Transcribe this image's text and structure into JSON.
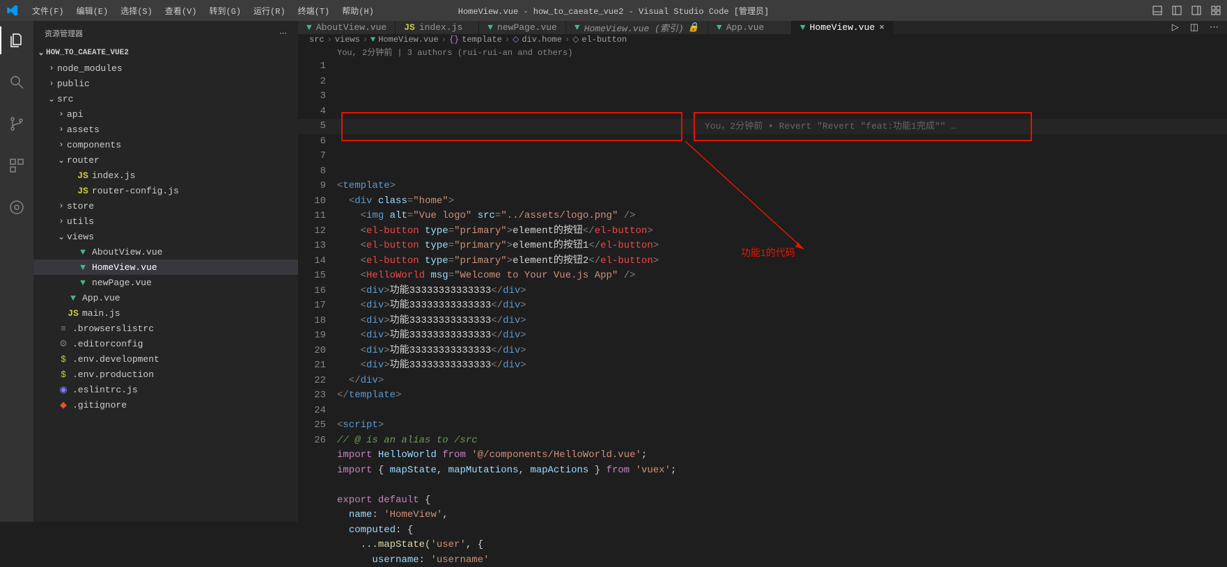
{
  "titlebar": {
    "menus": [
      "文件(F)",
      "编辑(E)",
      "选择(S)",
      "查看(V)",
      "转到(G)",
      "运行(R)",
      "终端(T)",
      "帮助(H)"
    ],
    "title": "HomeView.vue - how_to_caeate_vue2 - Visual Studio Code [管理员]"
  },
  "sidebar": {
    "header": "资源管理器",
    "section": "HOW_TO_CAEATE_VUE2",
    "tree": [
      {
        "d": 1,
        "t": "folder",
        "o": false,
        "label": "node_modules"
      },
      {
        "d": 1,
        "t": "folder",
        "o": false,
        "label": "public"
      },
      {
        "d": 1,
        "t": "folder",
        "o": true,
        "label": "src"
      },
      {
        "d": 2,
        "t": "folder",
        "o": false,
        "label": "api"
      },
      {
        "d": 2,
        "t": "folder",
        "o": false,
        "label": "assets"
      },
      {
        "d": 2,
        "t": "folder",
        "o": false,
        "label": "components"
      },
      {
        "d": 2,
        "t": "folder",
        "o": true,
        "label": "router"
      },
      {
        "d": 3,
        "t": "file",
        "ic": "js",
        "label": "index.js"
      },
      {
        "d": 3,
        "t": "file",
        "ic": "js",
        "label": "router-config.js"
      },
      {
        "d": 2,
        "t": "folder",
        "o": false,
        "label": "store"
      },
      {
        "d": 2,
        "t": "folder",
        "o": false,
        "label": "utils"
      },
      {
        "d": 2,
        "t": "folder",
        "o": true,
        "label": "views"
      },
      {
        "d": 3,
        "t": "file",
        "ic": "vue",
        "label": "AboutView.vue"
      },
      {
        "d": 3,
        "t": "file",
        "ic": "vue",
        "label": "HomeView.vue",
        "sel": true
      },
      {
        "d": 3,
        "t": "file",
        "ic": "vue",
        "label": "newPage.vue"
      },
      {
        "d": 2,
        "t": "file",
        "ic": "vue",
        "label": "App.vue"
      },
      {
        "d": 2,
        "t": "file",
        "ic": "js",
        "label": "main.js"
      },
      {
        "d": 1,
        "t": "file",
        "ic": "cfg",
        "label": ".browserslistrc"
      },
      {
        "d": 1,
        "t": "file",
        "ic": "cfg2",
        "label": ".editorconfig"
      },
      {
        "d": 1,
        "t": "file",
        "ic": "env",
        "label": ".env.development"
      },
      {
        "d": 1,
        "t": "file",
        "ic": "env",
        "label": ".env.production"
      },
      {
        "d": 1,
        "t": "file",
        "ic": "eslint",
        "label": ".eslintrc.js"
      },
      {
        "d": 1,
        "t": "file",
        "ic": "git",
        "label": ".gitignore"
      }
    ]
  },
  "tabs": [
    {
      "ic": "vue",
      "label": "AboutView.vue"
    },
    {
      "ic": "js",
      "label": "index.js"
    },
    {
      "ic": "vue",
      "label": "newPage.vue"
    },
    {
      "ic": "vue",
      "label": "HomeView.vue (索引)",
      "italic": true,
      "lock": true
    },
    {
      "ic": "vue",
      "label": "App.vue"
    },
    {
      "ic": "vue",
      "label": "HomeView.vue",
      "active": true
    }
  ],
  "breadcrumb": [
    "src",
    "views",
    "HomeView.vue",
    "{} template",
    "div.home",
    "el-button"
  ],
  "gitlens_top": "You, 2分钟前 | 3 authors (rui-rui-an and others)",
  "gitlens_inline": "You，2分钟前 • Revert \"Revert \"feat:功能1完成\"\" …",
  "annotation": "功能1的代码",
  "code": {
    "start": 1,
    "lines": [
      [
        [
          "t-bracket",
          "<"
        ],
        [
          "t-tag",
          "template"
        ],
        [
          "t-bracket",
          ">"
        ]
      ],
      [
        [
          "",
          "  "
        ],
        [
          "t-bracket",
          "<"
        ],
        [
          "t-tag",
          "div"
        ],
        [
          "",
          " "
        ],
        [
          "t-attr",
          "class"
        ],
        [
          "t-bracket",
          "="
        ],
        [
          "t-str",
          "\"home\""
        ],
        [
          "t-bracket",
          ">"
        ]
      ],
      [
        [
          "",
          "    "
        ],
        [
          "t-bracket",
          "<"
        ],
        [
          "t-tag",
          "img"
        ],
        [
          "",
          " "
        ],
        [
          "t-attr",
          "alt"
        ],
        [
          "t-bracket",
          "="
        ],
        [
          "t-str",
          "\"Vue logo\""
        ],
        [
          "",
          " "
        ],
        [
          "t-attr",
          "src"
        ],
        [
          "t-bracket",
          "="
        ],
        [
          "t-str",
          "\"../assets/logo.png\""
        ],
        [
          "",
          " "
        ],
        [
          "t-bracket",
          "/>"
        ]
      ],
      [
        [
          "",
          "    "
        ],
        [
          "t-bracket",
          "<"
        ],
        [
          "t-custom",
          "el-button"
        ],
        [
          "",
          " "
        ],
        [
          "t-attr",
          "type"
        ],
        [
          "t-bracket",
          "="
        ],
        [
          "t-str",
          "\"primary\""
        ],
        [
          "t-bracket",
          ">"
        ],
        [
          "t-text",
          "element的按钮"
        ],
        [
          "t-bracket",
          "</"
        ],
        [
          "t-custom",
          "el-button"
        ],
        [
          "t-bracket",
          ">"
        ]
      ],
      [
        [
          "",
          "    "
        ],
        [
          "t-bracket",
          "<"
        ],
        [
          "t-custom",
          "el-button"
        ],
        [
          "",
          " "
        ],
        [
          "t-attr",
          "type"
        ],
        [
          "t-bracket",
          "="
        ],
        [
          "t-str",
          "\"primary\""
        ],
        [
          "t-bracket",
          ">"
        ],
        [
          "t-text",
          "element的按钮1"
        ],
        [
          "t-bracket",
          "</"
        ],
        [
          "t-custom",
          "el-button"
        ],
        [
          "t-bracket",
          ">"
        ]
      ],
      [
        [
          "",
          "    "
        ],
        [
          "t-bracket",
          "<"
        ],
        [
          "t-custom",
          "el-button"
        ],
        [
          "",
          " "
        ],
        [
          "t-attr",
          "type"
        ],
        [
          "t-bracket",
          "="
        ],
        [
          "t-str",
          "\"primary\""
        ],
        [
          "t-bracket",
          ">"
        ],
        [
          "t-text",
          "element的按钮2"
        ],
        [
          "t-bracket",
          "</"
        ],
        [
          "t-custom",
          "el-button"
        ],
        [
          "t-bracket",
          ">"
        ]
      ],
      [
        [
          "",
          "    "
        ],
        [
          "t-bracket",
          "<"
        ],
        [
          "t-custom",
          "HelloWorld"
        ],
        [
          "",
          " "
        ],
        [
          "t-attr",
          "msg"
        ],
        [
          "t-bracket",
          "="
        ],
        [
          "t-str",
          "\"Welcome to Your Vue.js App\""
        ],
        [
          "",
          " "
        ],
        [
          "t-bracket",
          "/>"
        ]
      ],
      [
        [
          "",
          "    "
        ],
        [
          "t-bracket",
          "<"
        ],
        [
          "t-tag",
          "div"
        ],
        [
          "t-bracket",
          ">"
        ],
        [
          "t-text",
          "功能33333333333333"
        ],
        [
          "t-bracket",
          "</"
        ],
        [
          "t-tag",
          "div"
        ],
        [
          "t-bracket",
          ">"
        ]
      ],
      [
        [
          "",
          "    "
        ],
        [
          "t-bracket",
          "<"
        ],
        [
          "t-tag",
          "div"
        ],
        [
          "t-bracket",
          ">"
        ],
        [
          "t-text",
          "功能33333333333333"
        ],
        [
          "t-bracket",
          "</"
        ],
        [
          "t-tag",
          "div"
        ],
        [
          "t-bracket",
          ">"
        ]
      ],
      [
        [
          "",
          "    "
        ],
        [
          "t-bracket",
          "<"
        ],
        [
          "t-tag",
          "div"
        ],
        [
          "t-bracket",
          ">"
        ],
        [
          "t-text",
          "功能33333333333333"
        ],
        [
          "t-bracket",
          "</"
        ],
        [
          "t-tag",
          "div"
        ],
        [
          "t-bracket",
          ">"
        ]
      ],
      [
        [
          "",
          "    "
        ],
        [
          "t-bracket",
          "<"
        ],
        [
          "t-tag",
          "div"
        ],
        [
          "t-bracket",
          ">"
        ],
        [
          "t-text",
          "功能33333333333333"
        ],
        [
          "t-bracket",
          "</"
        ],
        [
          "t-tag",
          "div"
        ],
        [
          "t-bracket",
          ">"
        ]
      ],
      [
        [
          "",
          "    "
        ],
        [
          "t-bracket",
          "<"
        ],
        [
          "t-tag",
          "div"
        ],
        [
          "t-bracket",
          ">"
        ],
        [
          "t-text",
          "功能33333333333333"
        ],
        [
          "t-bracket",
          "</"
        ],
        [
          "t-tag",
          "div"
        ],
        [
          "t-bracket",
          ">"
        ]
      ],
      [
        [
          "",
          "    "
        ],
        [
          "t-bracket",
          "<"
        ],
        [
          "t-tag",
          "div"
        ],
        [
          "t-bracket",
          ">"
        ],
        [
          "t-text",
          "功能33333333333333"
        ],
        [
          "t-bracket",
          "</"
        ],
        [
          "t-tag",
          "div"
        ],
        [
          "t-bracket",
          ">"
        ]
      ],
      [
        [
          "",
          "  "
        ],
        [
          "t-bracket",
          "</"
        ],
        [
          "t-tag",
          "div"
        ],
        [
          "t-bracket",
          ">"
        ]
      ],
      [
        [
          "t-bracket",
          "</"
        ],
        [
          "t-tag",
          "template"
        ],
        [
          "t-bracket",
          ">"
        ]
      ],
      [],
      [
        [
          "t-bracket",
          "<"
        ],
        [
          "t-tag",
          "script"
        ],
        [
          "t-bracket",
          ">"
        ]
      ],
      [
        [
          "t-cmt",
          "// @ is an alias to /src"
        ]
      ],
      [
        [
          "t-kw",
          "import"
        ],
        [
          "",
          " "
        ],
        [
          "t-var",
          "HelloWorld"
        ],
        [
          "",
          " "
        ],
        [
          "t-kw",
          "from"
        ],
        [
          "",
          " "
        ],
        [
          "t-str",
          "'@/components/HelloWorld.vue'"
        ],
        [
          "t-text",
          ";"
        ]
      ],
      [
        [
          "t-kw",
          "import"
        ],
        [
          "",
          " { "
        ],
        [
          "t-var",
          "mapState"
        ],
        [
          "t-text",
          ", "
        ],
        [
          "t-var",
          "mapMutations"
        ],
        [
          "t-text",
          ", "
        ],
        [
          "t-var",
          "mapActions"
        ],
        [
          "",
          " } "
        ],
        [
          "t-kw",
          "from"
        ],
        [
          "",
          " "
        ],
        [
          "t-str",
          "'vuex'"
        ],
        [
          "t-text",
          ";"
        ]
      ],
      [],
      [
        [
          "t-kw",
          "export"
        ],
        [
          "",
          " "
        ],
        [
          "t-kw",
          "default"
        ],
        [
          "",
          " {"
        ]
      ],
      [
        [
          "",
          "  "
        ],
        [
          "t-var",
          "name"
        ],
        [
          "t-text",
          ": "
        ],
        [
          "t-str",
          "'HomeView'"
        ],
        [
          "t-text",
          ","
        ]
      ],
      [
        [
          "",
          "  "
        ],
        [
          "t-var",
          "computed"
        ],
        [
          "t-text",
          ": {"
        ]
      ],
      [
        [
          "",
          "    ..."
        ],
        [
          "t-fn",
          "mapState"
        ],
        [
          "t-text",
          "("
        ],
        [
          "t-str",
          "'user'"
        ],
        [
          "t-text",
          ", {"
        ]
      ],
      [
        [
          "",
          "      "
        ],
        [
          "t-var",
          "username"
        ],
        [
          "t-text",
          ": "
        ],
        [
          "t-str",
          "'username'"
        ]
      ]
    ]
  }
}
